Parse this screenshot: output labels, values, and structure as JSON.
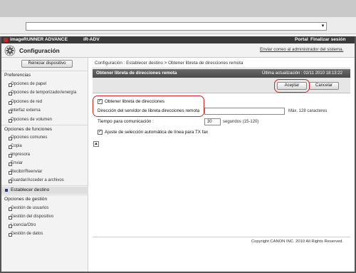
{
  "header": {
    "product": "imageRUNNER ADVANCE",
    "device": "iR-ADV",
    "portal": "Portal",
    "logout": "Finalizar sesión"
  },
  "title_bar": {
    "heading": "Configuración",
    "email_admin": "Enviar correo al administrador del sistema."
  },
  "sidebar": {
    "restart_button": "Reiniciar dispositivo",
    "preferences": {
      "label": "Preferencias",
      "items": [
        "Opciones de papel",
        "Opciones de temporizador/energía",
        "Opciones de red",
        "Interfaz externa",
        "Opciones de volumen"
      ]
    },
    "function_settings": {
      "label": "Opciones de funciones",
      "items": [
        "Opciones comunes",
        "Copia",
        "Impresora",
        "Enviar",
        "Recibir/Reenviar",
        "Guardar/Acceder a archivos"
      ]
    },
    "selected": "Establecer destino",
    "management": {
      "label": "Opciones de gestión",
      "items": [
        "Gestión de usuarios",
        "Gestión del dispositivo",
        "Licencia/Otro",
        "Gestión de datos"
      ]
    }
  },
  "main": {
    "breadcrumb": "Configuración : Establecer destino > Obtener libreta de direcciones remota",
    "panel_title": "Obtener libreta de direcciones remota",
    "last_update": "Última actualización : 02/11 2010 18:13:22",
    "ok_button": "Aceptar",
    "cancel_button": "Cancelar",
    "obtain_label": "Obtener libreta de direcciones",
    "obtain_checked": true,
    "server_label": "Dirección del servidor de libreta direcciones remota",
    "server_value": "",
    "server_hint": "Máx. 128 caracteres",
    "timeout_label": "Tiempo para comunicación :",
    "timeout_value": "30",
    "timeout_unit": "segundos (15-120)",
    "auto_label": "Ajuste de selección automática de línea para TX fax",
    "auto_checked": true
  },
  "footer": {
    "copyright": "Copyright CANON INC. 2010 All Rights Reserved."
  },
  "colors": {
    "header": "#3a3a3a",
    "panel_header": "#555555",
    "highlight": "#d32626",
    "selected_bullet": "#1f3f8f"
  },
  "icons": [
    "gear-icon",
    "dropdown-arrow-icon",
    "checkbox-icon",
    "top-of-page-icon",
    "canon-logo-icon"
  ]
}
